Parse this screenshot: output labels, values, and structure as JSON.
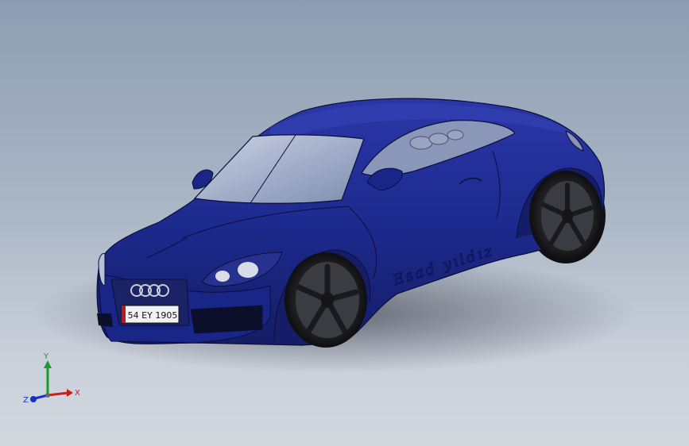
{
  "viewport": {
    "background_top": "#8e9db2",
    "background_bottom": "#d3d8df"
  },
  "model": {
    "body_color": "#1d2a8e",
    "license_plate": "54 EY 1905",
    "signature_text": "Esad yıldız"
  },
  "triad": {
    "x_label": "X",
    "y_label": "Y",
    "z_label": "Z",
    "x_color": "#c8201c",
    "y_color": "#1e9a2a",
    "z_color": "#1a2fc8"
  }
}
